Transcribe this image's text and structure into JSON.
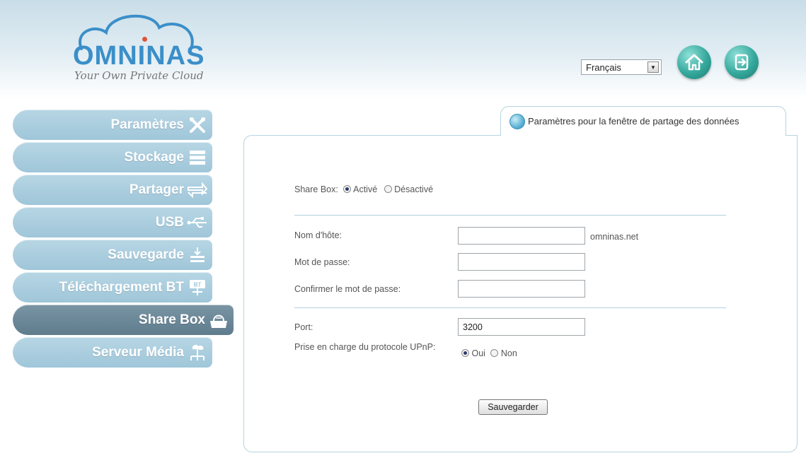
{
  "header": {
    "brand": "OMNINAS",
    "tagline": "Your Own Private Cloud",
    "language": "Français",
    "home_icon": "home-icon",
    "logout_icon": "logout-icon"
  },
  "sidebar": {
    "items": [
      {
        "label": "Paramètres",
        "icon": "tools-icon"
      },
      {
        "label": "Stockage",
        "icon": "storage-icon"
      },
      {
        "label": "Partager",
        "icon": "share-arrows-icon"
      },
      {
        "label": "USB",
        "icon": "usb-icon"
      },
      {
        "label": "Sauvegarde",
        "icon": "backup-icon"
      },
      {
        "label": "Téléchargement BT",
        "icon": "bt-download-icon"
      },
      {
        "label": "Share Box",
        "icon": "share-box-icon",
        "active": true
      },
      {
        "label": "Serveur Média",
        "icon": "media-server-icon"
      }
    ]
  },
  "panel": {
    "tab_title": "Paramètres pour la fenêtre de partage des données",
    "sharebox": {
      "label": "Share Box:",
      "option_on": "Activé",
      "option_off": "Désactivé",
      "selected": "Activé"
    },
    "hostname": {
      "label": "Nom d'hôte:",
      "value": "",
      "suffix": "omninas.net"
    },
    "password": {
      "label": "Mot de passe:",
      "value": ""
    },
    "confirm_password": {
      "label": "Confirmer le mot de passe:",
      "value": ""
    },
    "port": {
      "label": "Port:",
      "value": "3200"
    },
    "upnp": {
      "label": "Prise en charge du protocole UPnP:",
      "option_yes": "Oui",
      "option_no": "Non",
      "selected": "Oui"
    },
    "save_label": "Sauvegarder"
  },
  "colors": {
    "sidebar_item": "#a8cde0",
    "sidebar_active": "#6a8797",
    "accent": "#3b8fc8",
    "panel_border": "#b7d3df"
  }
}
